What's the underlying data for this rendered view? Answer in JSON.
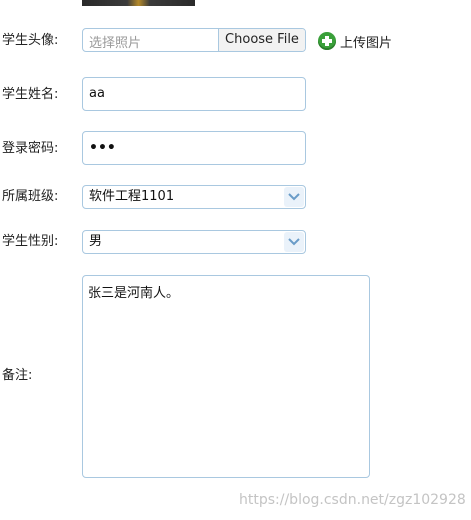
{
  "form": {
    "avatar": {
      "label": "学生头像:",
      "placeholder": "选择照片",
      "choose_button": "Choose File",
      "upload_label": "上传图片"
    },
    "name": {
      "label": "学生姓名:",
      "value": "aa"
    },
    "password": {
      "label": "登录密码:",
      "value": "•••"
    },
    "class": {
      "label": "所属班级:",
      "selected": "软件工程1101"
    },
    "gender": {
      "label": "学生性别:",
      "selected": "男"
    },
    "remark": {
      "label": "备注:",
      "value": "张三是河南人。"
    }
  },
  "watermark": "https://blog.csdn.net/zgz102928",
  "colors": {
    "border": "#a9c8e0",
    "upload_icon": "#3aa03a"
  }
}
